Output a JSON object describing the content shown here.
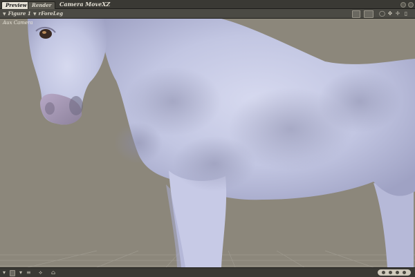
{
  "tabs": [
    {
      "label": "Preview",
      "active": true
    },
    {
      "label": "Render",
      "active": false
    }
  ],
  "viewport_title": "Camera MoveXZ",
  "toolbar": {
    "figure_dropdown": "Figure 1",
    "part_dropdown": "rForeLeg",
    "icons": [
      "document-icon",
      "folder-icon",
      "circle-icon",
      "move-icon",
      "cross-icon",
      "thermometer-icon"
    ]
  },
  "viewport": {
    "camera_label": "Aux Camera",
    "background_color": "#8c877b",
    "subject": "horse"
  },
  "bottombar": {
    "icons": [
      "menu-icon",
      "square-icon",
      "menu2-icon",
      "lines-icon",
      "fork-icon",
      "hat-icon"
    ]
  },
  "colors": {
    "chrome_dark": "#2b2a26",
    "toolbar": "#4b4a44",
    "tab_active": "#e6e2d6",
    "horse_coat": "#c9cde6"
  }
}
